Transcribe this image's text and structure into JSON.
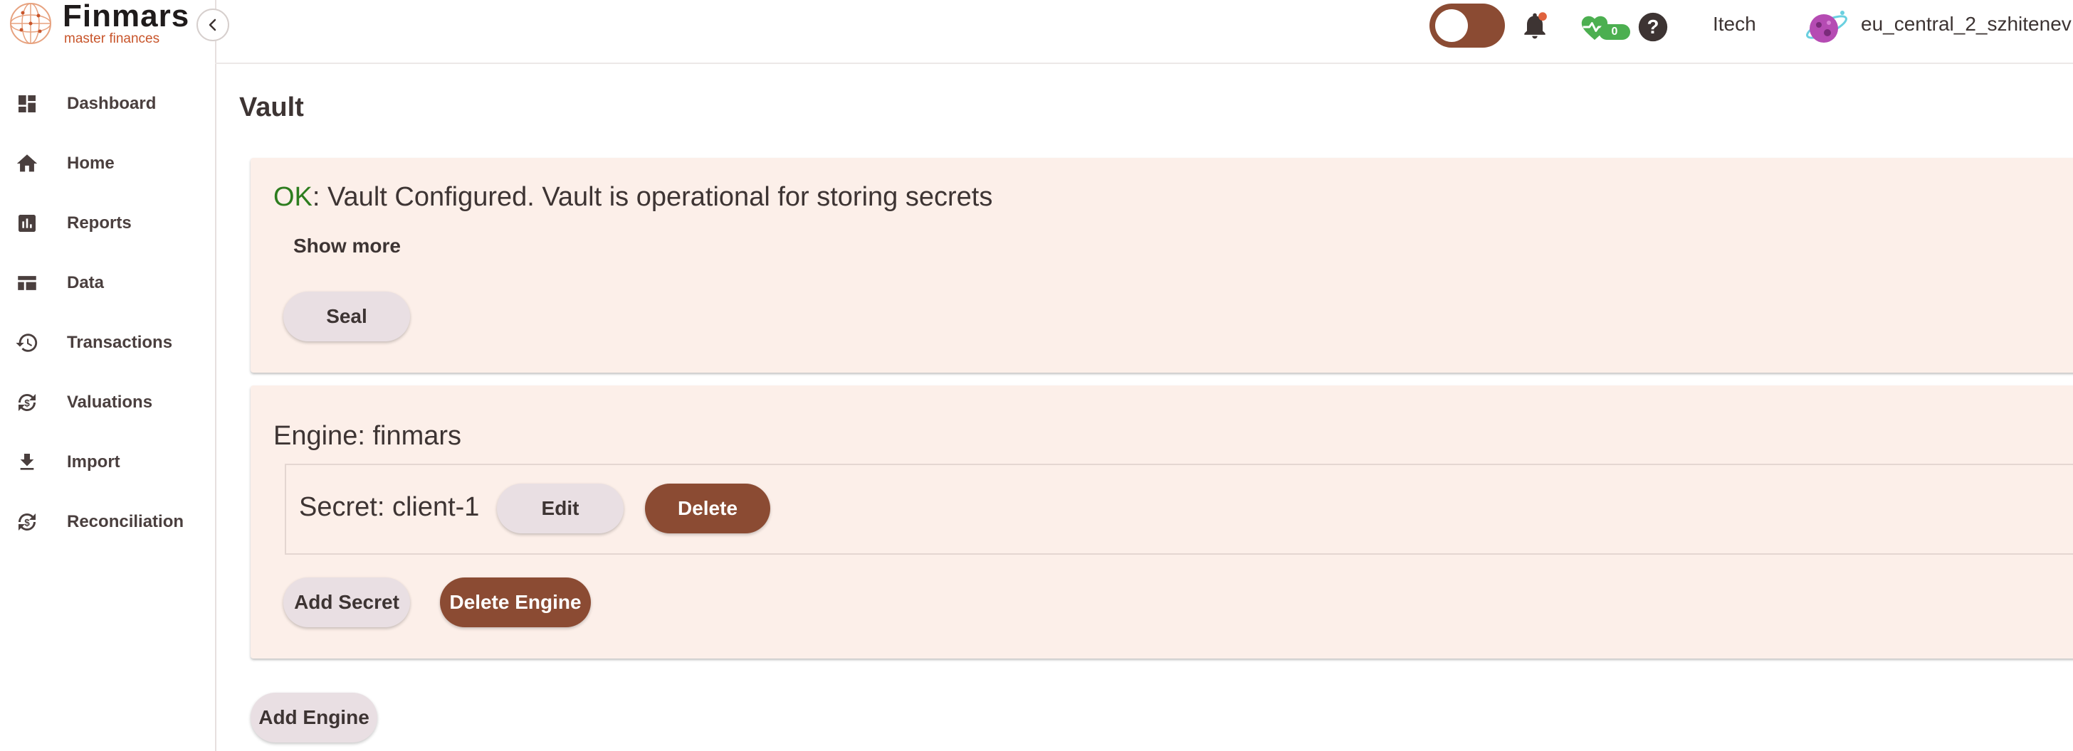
{
  "brand": {
    "name": "Finmars",
    "tagline": "master finances"
  },
  "sidebar": {
    "items": [
      {
        "label": "Dashboard",
        "icon": "dashboard-icon"
      },
      {
        "label": "Home",
        "icon": "home-icon"
      },
      {
        "label": "Reports",
        "icon": "bar-chart-icon"
      },
      {
        "label": "Data",
        "icon": "table-icon"
      },
      {
        "label": "Transactions",
        "icon": "history-icon"
      },
      {
        "label": "Valuations",
        "icon": "currency-sync-icon"
      },
      {
        "label": "Import",
        "icon": "download-icon"
      },
      {
        "label": "Reconciliation",
        "icon": "currency-sync-icon"
      }
    ]
  },
  "header": {
    "health_count": "0",
    "workspace": "Itech",
    "user": "eu_central_2_szhitenev"
  },
  "page": {
    "title": "Vault",
    "status": {
      "code": "OK",
      "message": ": Vault Configured. Vault is operational for storing secrets",
      "show_more": "Show more",
      "seal_label": "Seal"
    },
    "engine": {
      "title": "Engine: finmars",
      "secret": {
        "label": "Secret: client-1",
        "edit_label": "Edit",
        "delete_label": "Delete"
      },
      "add_secret_label": "Add Secret",
      "delete_engine_label": "Delete Engine"
    },
    "add_engine_label": "Add Engine"
  },
  "colors": {
    "accent": "#8b4b33",
    "card_bg": "#fcefe9",
    "ok_green": "#2d7d1f",
    "brand_orange": "#c8552b",
    "health_green": "#4caf50"
  }
}
